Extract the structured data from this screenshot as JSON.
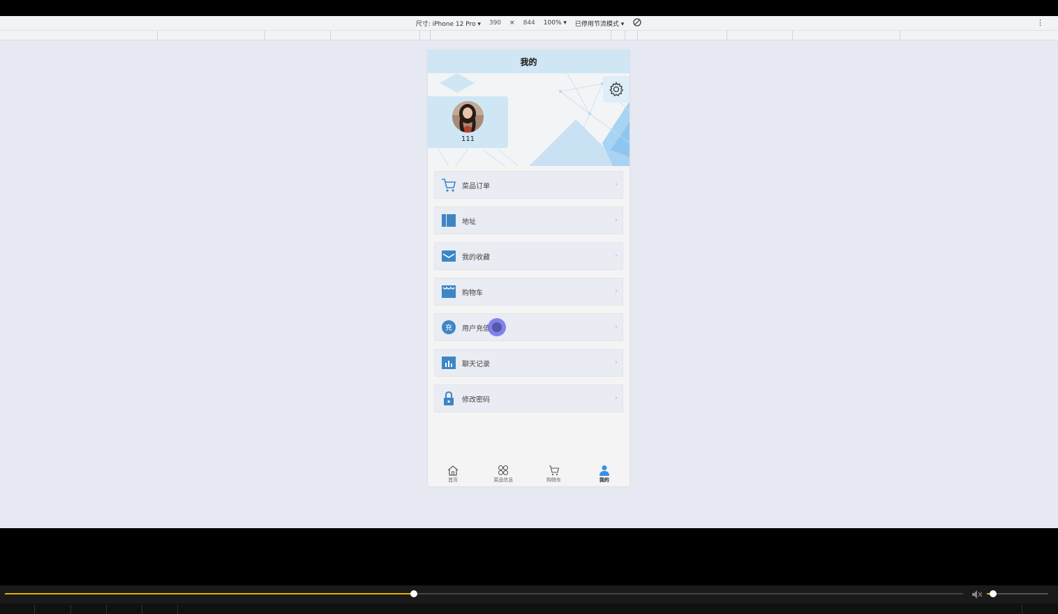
{
  "devtools": {
    "device_label": "尺寸: iPhone 12 Pro ▾",
    "width": "390",
    "times": "×",
    "height": "844",
    "zoom": "100% ▾",
    "throttle": "已停用节流模式 ▾",
    "more": "⋮"
  },
  "page": {
    "title": "我的",
    "username": "111"
  },
  "menu": {
    "items": [
      {
        "label": "菜品订单",
        "icon": "cart-icon"
      },
      {
        "label": "地址",
        "icon": "address-icon"
      },
      {
        "label": "我的收藏",
        "icon": "favorite-icon"
      },
      {
        "label": "购物车",
        "icon": "shop-icon"
      },
      {
        "label": "用户充值",
        "icon": "recharge-icon"
      },
      {
        "label": "聊天记录",
        "icon": "chart-icon"
      },
      {
        "label": "修改密码",
        "icon": "lock-icon"
      }
    ],
    "chevron": "›",
    "recharge_glyph": "充"
  },
  "tabbar": {
    "items": [
      {
        "label": "首页",
        "icon": "home-icon",
        "active": false
      },
      {
        "label": "菜品信息",
        "icon": "grid-icon",
        "active": false
      },
      {
        "label": "购物车",
        "icon": "cart-icon",
        "active": false
      },
      {
        "label": "我的",
        "icon": "user-icon",
        "active": true
      }
    ]
  },
  "player": {
    "progress": 0.427,
    "volume": 0.1
  },
  "colors": {
    "accent": "#3d86c6",
    "header_bg": "#cfe6f4",
    "active_tab": "#3a8ee6"
  }
}
